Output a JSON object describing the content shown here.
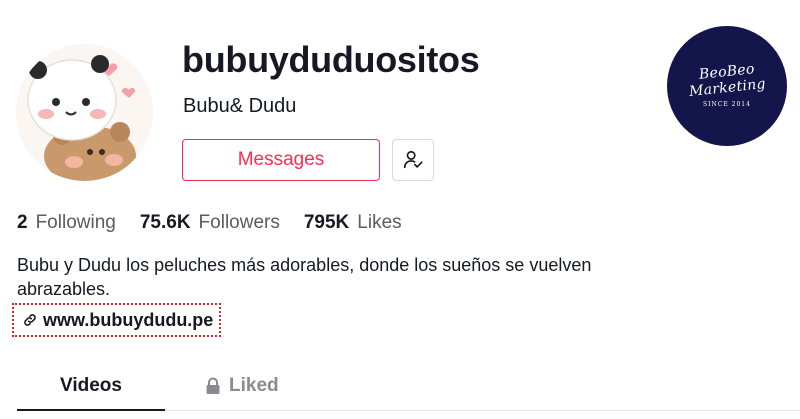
{
  "profile": {
    "username": "bubuyduduositos",
    "display_name": "Bubu& Dudu",
    "avatar_icon": "bear-panda-avatar-icon"
  },
  "actions": {
    "messages_label": "Messages",
    "follow_icon": "user-check-icon"
  },
  "brand": {
    "line1": "BeoBeo",
    "line2": "Marketing",
    "since": "SINCE 2014",
    "color": "#14154a"
  },
  "stats": [
    {
      "value": "2",
      "label": "Following"
    },
    {
      "value": "75.6K",
      "label": "Followers"
    },
    {
      "value": "795K",
      "label": "Likes"
    }
  ],
  "bio": "Bubu y Dudu los peluches más adorables, donde los sueños se vuelven abrazables.",
  "link": {
    "icon": "link-icon",
    "text": "www.bubuydudu.pe"
  },
  "tabs": [
    {
      "label": "Videos",
      "active": true
    },
    {
      "label": "Liked",
      "icon": "lock-icon",
      "active": false
    }
  ],
  "colors": {
    "accent": "#fe2c55",
    "text": "#161823",
    "muted": "#5a5b63",
    "highlight_border": "#e02424"
  }
}
